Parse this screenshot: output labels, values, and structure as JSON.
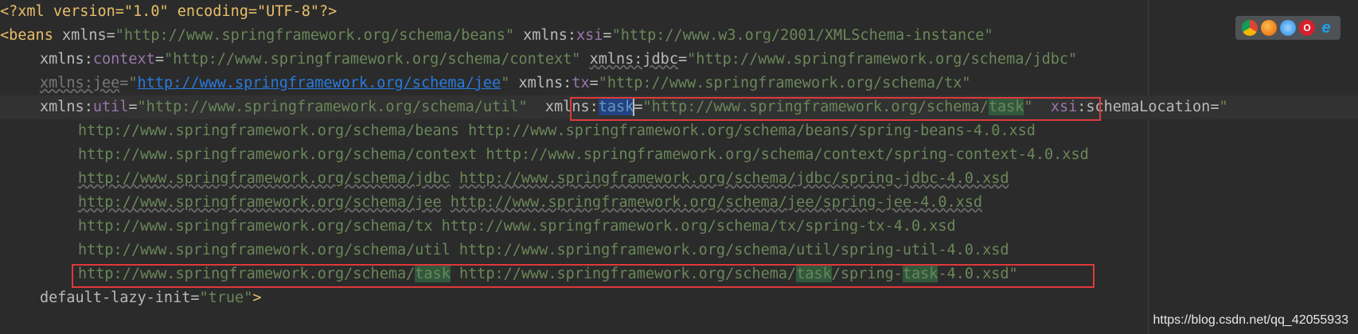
{
  "editor": {
    "line0": {
      "decl": "<?xml version=\"1.0\" encoding=\"UTF-8\"?>"
    },
    "line1": {
      "open": "<beans",
      "a1": " xmlns=",
      "v1": "\"http://www.springframework.org/schema/beans\"",
      "a2_ns": "xmlns",
      "a2_colon": ":",
      "a2_local": "xsi",
      "a2_eq": "=",
      "v2": "\"http://www.w3.org/2001/XMLSchema-instance\""
    },
    "line2": {
      "a1_ns": "xmlns",
      "a1_colon": ":",
      "a1_local": "context",
      "a1_eq": "=",
      "v1": "\"http://www.springframework.org/schema/context\"",
      "a2": "xmlns:jdbc",
      "a2_eq": "=",
      "v2": "\"http://www.springframework.org/schema/jdbc\""
    },
    "line3": {
      "a1": "xmlns:jee",
      "a1_eq": "=",
      "q1": "\"",
      "link1": "http://www.springframework.org/schema/jee",
      "q2": "\"",
      "a2_ns": "xmlns",
      "a2_colon": ":",
      "a2_local": "tx",
      "a2_eq": "=",
      "v2": "\"http://www.springframework.org/schema/tx\""
    },
    "line4": {
      "a1_ns": "xmlns",
      "a1_colon": ":",
      "a1_local": "util",
      "a1_eq": "=",
      "v1": "\"http://www.springframework.org/schema/util\"",
      "a2_ns": "xmlns",
      "a2_colon": ":",
      "a2_local": "task",
      "a2_eq": "=",
      "v2_pre": "\"http://www.springframework.org/schema/",
      "v2_task": "task",
      "v2_post": "\"",
      "a3_ns": "xsi",
      "a3_colon": ":",
      "a3_local": "schemaLocation",
      "a3_eq": "=",
      "q": "\""
    },
    "line5": {
      "text": "http://www.springframework.org/schema/beans http://www.springframework.org/schema/beans/spring-beans-4.0.xsd"
    },
    "line6": {
      "text": "http://www.springframework.org/schema/context http://www.springframework.org/schema/context/spring-context-4.0.xsd"
    },
    "line7": {
      "u1": "http://www.springframework.org/schema/jdbc",
      "sp": " ",
      "u2": "http://www.springframework.org/schema/jdbc/spring-jdbc-4.0.xsd"
    },
    "line8": {
      "u1": "http://www.springframework.org/schema/jee",
      "sp": " ",
      "u2": "http://www.springframework.org/schema/jee/spring-jee-4.0.xsd"
    },
    "line9": {
      "text": "http://www.springframework.org/schema/tx http://www.springframework.org/schema/tx/spring-tx-4.0.xsd"
    },
    "line10": {
      "text": "http://www.springframework.org/schema/util http://www.springframework.org/schema/util/spring-util-4.0.xsd"
    },
    "line11": {
      "p1": "http://www.springframework.org/schema/",
      "t1": "task",
      "p2": " http://www.springframework.org/schema/",
      "t2": "task",
      "p3": "/spring-",
      "t3": "task",
      "p4": "-4.0.xsd\""
    },
    "line12": {
      "a": "default-lazy-init",
      "eq": "=",
      "v": "\"true\"",
      "close": ">"
    }
  },
  "browser_icons": [
    "chrome-icon",
    "firefox-icon",
    "safari-icon",
    "opera-icon",
    "ie-icon"
  ],
  "browser_glyphs": {
    "opera": "O",
    "ie": "e"
  },
  "watermark": "https://blog.csdn.net/qq_42055933",
  "colors": {
    "background": "#2b2b2b",
    "tag": "#e8bf6a",
    "namespace": "#9876aa",
    "string": "#6a8759",
    "link": "#287bde",
    "highlight_box": "#e0393b",
    "task_highlight": "#32593d",
    "selection": "#214283"
  }
}
